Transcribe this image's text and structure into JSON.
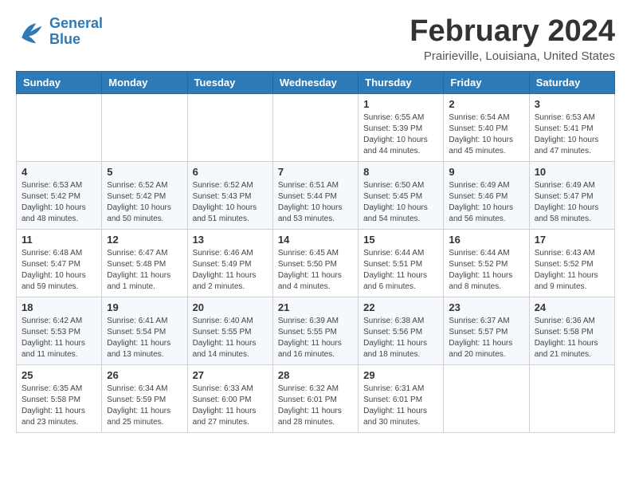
{
  "header": {
    "logo_line1": "General",
    "logo_line2": "Blue",
    "month_title": "February 2024",
    "location": "Prairieville, Louisiana, United States"
  },
  "weekdays": [
    "Sunday",
    "Monday",
    "Tuesday",
    "Wednesday",
    "Thursday",
    "Friday",
    "Saturday"
  ],
  "weeks": [
    [
      {
        "day": "",
        "info": ""
      },
      {
        "day": "",
        "info": ""
      },
      {
        "day": "",
        "info": ""
      },
      {
        "day": "",
        "info": ""
      },
      {
        "day": "1",
        "info": "Sunrise: 6:55 AM\nSunset: 5:39 PM\nDaylight: 10 hours\nand 44 minutes."
      },
      {
        "day": "2",
        "info": "Sunrise: 6:54 AM\nSunset: 5:40 PM\nDaylight: 10 hours\nand 45 minutes."
      },
      {
        "day": "3",
        "info": "Sunrise: 6:53 AM\nSunset: 5:41 PM\nDaylight: 10 hours\nand 47 minutes."
      }
    ],
    [
      {
        "day": "4",
        "info": "Sunrise: 6:53 AM\nSunset: 5:42 PM\nDaylight: 10 hours\nand 48 minutes."
      },
      {
        "day": "5",
        "info": "Sunrise: 6:52 AM\nSunset: 5:42 PM\nDaylight: 10 hours\nand 50 minutes."
      },
      {
        "day": "6",
        "info": "Sunrise: 6:52 AM\nSunset: 5:43 PM\nDaylight: 10 hours\nand 51 minutes."
      },
      {
        "day": "7",
        "info": "Sunrise: 6:51 AM\nSunset: 5:44 PM\nDaylight: 10 hours\nand 53 minutes."
      },
      {
        "day": "8",
        "info": "Sunrise: 6:50 AM\nSunset: 5:45 PM\nDaylight: 10 hours\nand 54 minutes."
      },
      {
        "day": "9",
        "info": "Sunrise: 6:49 AM\nSunset: 5:46 PM\nDaylight: 10 hours\nand 56 minutes."
      },
      {
        "day": "10",
        "info": "Sunrise: 6:49 AM\nSunset: 5:47 PM\nDaylight: 10 hours\nand 58 minutes."
      }
    ],
    [
      {
        "day": "11",
        "info": "Sunrise: 6:48 AM\nSunset: 5:47 PM\nDaylight: 10 hours\nand 59 minutes."
      },
      {
        "day": "12",
        "info": "Sunrise: 6:47 AM\nSunset: 5:48 PM\nDaylight: 11 hours\nand 1 minute."
      },
      {
        "day": "13",
        "info": "Sunrise: 6:46 AM\nSunset: 5:49 PM\nDaylight: 11 hours\nand 2 minutes."
      },
      {
        "day": "14",
        "info": "Sunrise: 6:45 AM\nSunset: 5:50 PM\nDaylight: 11 hours\nand 4 minutes."
      },
      {
        "day": "15",
        "info": "Sunrise: 6:44 AM\nSunset: 5:51 PM\nDaylight: 11 hours\nand 6 minutes."
      },
      {
        "day": "16",
        "info": "Sunrise: 6:44 AM\nSunset: 5:52 PM\nDaylight: 11 hours\nand 8 minutes."
      },
      {
        "day": "17",
        "info": "Sunrise: 6:43 AM\nSunset: 5:52 PM\nDaylight: 11 hours\nand 9 minutes."
      }
    ],
    [
      {
        "day": "18",
        "info": "Sunrise: 6:42 AM\nSunset: 5:53 PM\nDaylight: 11 hours\nand 11 minutes."
      },
      {
        "day": "19",
        "info": "Sunrise: 6:41 AM\nSunset: 5:54 PM\nDaylight: 11 hours\nand 13 minutes."
      },
      {
        "day": "20",
        "info": "Sunrise: 6:40 AM\nSunset: 5:55 PM\nDaylight: 11 hours\nand 14 minutes."
      },
      {
        "day": "21",
        "info": "Sunrise: 6:39 AM\nSunset: 5:55 PM\nDaylight: 11 hours\nand 16 minutes."
      },
      {
        "day": "22",
        "info": "Sunrise: 6:38 AM\nSunset: 5:56 PM\nDaylight: 11 hours\nand 18 minutes."
      },
      {
        "day": "23",
        "info": "Sunrise: 6:37 AM\nSunset: 5:57 PM\nDaylight: 11 hours\nand 20 minutes."
      },
      {
        "day": "24",
        "info": "Sunrise: 6:36 AM\nSunset: 5:58 PM\nDaylight: 11 hours\nand 21 minutes."
      }
    ],
    [
      {
        "day": "25",
        "info": "Sunrise: 6:35 AM\nSunset: 5:58 PM\nDaylight: 11 hours\nand 23 minutes."
      },
      {
        "day": "26",
        "info": "Sunrise: 6:34 AM\nSunset: 5:59 PM\nDaylight: 11 hours\nand 25 minutes."
      },
      {
        "day": "27",
        "info": "Sunrise: 6:33 AM\nSunset: 6:00 PM\nDaylight: 11 hours\nand 27 minutes."
      },
      {
        "day": "28",
        "info": "Sunrise: 6:32 AM\nSunset: 6:01 PM\nDaylight: 11 hours\nand 28 minutes."
      },
      {
        "day": "29",
        "info": "Sunrise: 6:31 AM\nSunset: 6:01 PM\nDaylight: 11 hours\nand 30 minutes."
      },
      {
        "day": "",
        "info": ""
      },
      {
        "day": "",
        "info": ""
      }
    ]
  ]
}
